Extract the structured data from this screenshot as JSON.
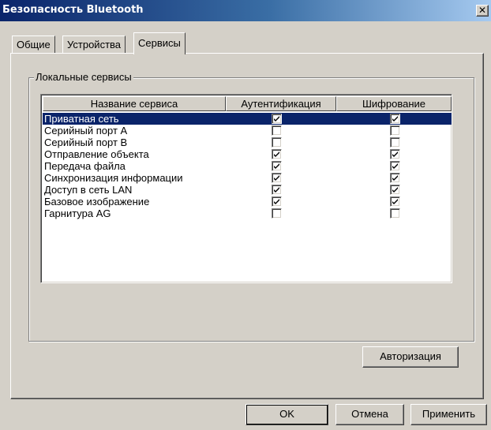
{
  "window": {
    "title": "Безопасность Bluetooth",
    "close_glyph": "✕"
  },
  "tabs": [
    {
      "label": "Общие",
      "active": false
    },
    {
      "label": "Устройства",
      "active": false
    },
    {
      "label": "Сервисы",
      "active": true
    }
  ],
  "group": {
    "label": "Локальные сервисы"
  },
  "list": {
    "columns": [
      "Название сервиса",
      "Аутентификация",
      "Шифрование"
    ],
    "rows": [
      {
        "name": "Приватная сеть",
        "auth": true,
        "enc": true,
        "selected": true
      },
      {
        "name": "Серийный порт A",
        "auth": false,
        "enc": false,
        "selected": false
      },
      {
        "name": "Серийный порт B",
        "auth": false,
        "enc": false,
        "selected": false
      },
      {
        "name": "Отправление объекта",
        "auth": true,
        "enc": true,
        "selected": false
      },
      {
        "name": "Передача файла",
        "auth": true,
        "enc": true,
        "selected": false
      },
      {
        "name": "Синхронизация информации",
        "auth": true,
        "enc": true,
        "selected": false
      },
      {
        "name": "Доступ в сеть LAN",
        "auth": true,
        "enc": true,
        "selected": false
      },
      {
        "name": "Базовое изображение",
        "auth": true,
        "enc": true,
        "selected": false
      },
      {
        "name": "Гарнитура AG",
        "auth": false,
        "enc": false,
        "selected": false
      }
    ]
  },
  "buttons": {
    "authorize": "Авторизация",
    "ok": "OK",
    "cancel": "Отмена",
    "apply": "Применить"
  }
}
